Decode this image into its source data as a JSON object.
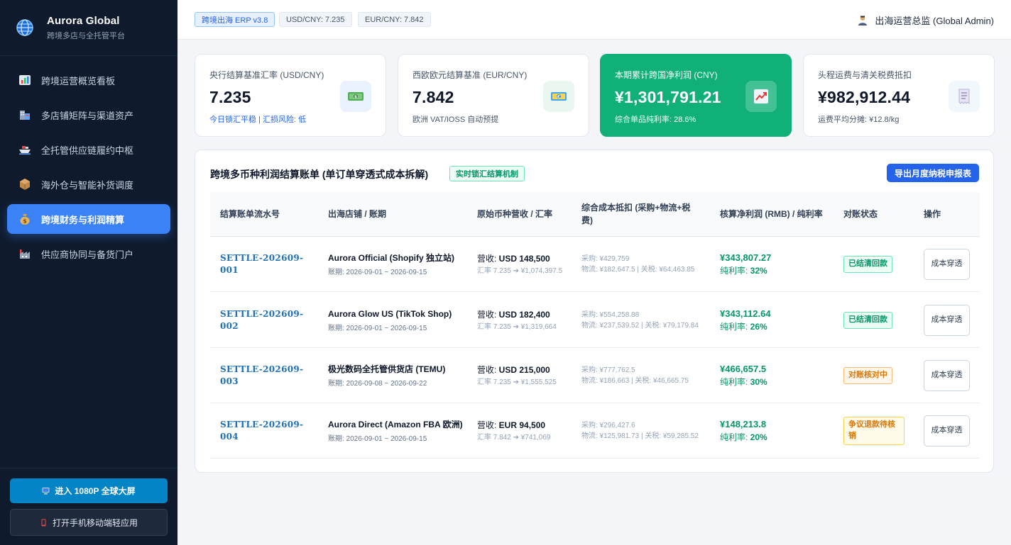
{
  "brand": {
    "title": "Aurora Global",
    "subtitle": "跨境多店与全托管平台"
  },
  "nav": [
    {
      "label": "跨境运营概览看板",
      "icon": "bar-chart-icon",
      "active": false
    },
    {
      "label": "多店铺矩阵与渠道资产",
      "icon": "store-icon",
      "active": false
    },
    {
      "label": "全托管供应链履约中枢",
      "icon": "ship-icon",
      "active": false
    },
    {
      "label": "海外仓与智能补货调度",
      "icon": "package-icon",
      "active": false
    },
    {
      "label": "跨境财务与利润精算",
      "icon": "money-bag-icon",
      "active": true
    },
    {
      "label": "供应商协同与备货门户",
      "icon": "factory-icon",
      "active": false
    }
  ],
  "sidebar_buttons": {
    "big_screen": "进入 1080P 全球大屏",
    "mobile": "打开手机移动端轻应用"
  },
  "topbar": {
    "erp_tag": "跨境出海 ERP v3.8",
    "rate_usd": "USD/CNY: 7.235",
    "rate_eur": "EUR/CNY: 7.842",
    "user": "出海运营总监 (Global Admin)"
  },
  "cards": [
    {
      "label": "央行结算基准汇率 (USD/CNY)",
      "value": "7.235",
      "note": "今日锁汇平稳 | 汇损风险: 低",
      "icon": "dollar-bill-icon"
    },
    {
      "label": "西欧欧元结算基准 (EUR/CNY)",
      "value": "7.842",
      "note": "欧洲 VAT/IOSS 自动预提",
      "icon": "euro-bill-icon"
    },
    {
      "label": "本期累计跨国净利润 (CNY)",
      "value": "¥1,301,791.21",
      "note": "综合单品纯利率: 28.6%",
      "icon": "trend-up-icon"
    },
    {
      "label": "头程运费与清关税费抵扣",
      "value": "¥982,912.44",
      "note": "运费平均分摊: ¥12.8/kg",
      "icon": "receipt-icon"
    }
  ],
  "ledger": {
    "title": "跨境多币种利润结算账单 (单订单穿透式成本拆解)",
    "tag": "实时锁汇结算机制",
    "export_label": "导出月度纳税申报表",
    "headers": [
      "结算账单流水号",
      "出海店铺 / 账期",
      "原始币种营收 / 汇率",
      "综合成本抵扣 (采购+物流+税费)",
      "核算净利润 (RMB) / 纯利率",
      "对账状态",
      "操作"
    ],
    "rows": [
      {
        "id": "SETTLE-202609-001",
        "store": "Aurora Official (Shopify 独立站)",
        "period": "账期: 2026-09-01 ~ 2026-09-15",
        "rev_prefix": "营收: ",
        "rev_amount": "USD 148,500",
        "rate_note": "汇率 7.235 ➔ ¥1,074,397.5",
        "cost_purchase": "采购: ¥429,759",
        "cost_logistics": "物流: ¥182,647.5 | 关税: ¥64,463.85",
        "profit": "¥343,807.27",
        "margin_prefix": "纯利率: ",
        "margin": "32%",
        "status": "已结清回款",
        "status_type": "ok",
        "action": "成本穿透"
      },
      {
        "id": "SETTLE-202609-002",
        "store": "Aurora Glow US (TikTok Shop)",
        "period": "账期: 2026-09-01 ~ 2026-09-15",
        "rev_prefix": "营收: ",
        "rev_amount": "USD 182,400",
        "rate_note": "汇率 7.235 ➔ ¥1,319,664",
        "cost_purchase": "采购: ¥554,258.88",
        "cost_logistics": "物流: ¥237,539.52 | 关税: ¥79,179.84",
        "profit": "¥343,112.64",
        "margin_prefix": "纯利率: ",
        "margin": "26%",
        "status": "已结清回款",
        "status_type": "ok",
        "action": "成本穿透"
      },
      {
        "id": "SETTLE-202609-003",
        "store": "极光数码全托管供货店 (TEMU)",
        "period": "账期: 2026-09-08 ~ 2026-09-22",
        "rev_prefix": "营收: ",
        "rev_amount": "USD 215,000",
        "rate_note": "汇率 7.235 ➔ ¥1,555,525",
        "cost_purchase": "采购: ¥777,762.5",
        "cost_logistics": "物流: ¥186,663 | 关税: ¥46,665.75",
        "profit": "¥466,657.5",
        "margin_prefix": "纯利率: ",
        "margin": "30%",
        "status": "对账核对中",
        "status_type": "pending",
        "action": "成本穿透"
      },
      {
        "id": "SETTLE-202609-004",
        "store": "Aurora Direct (Amazon FBA 欧洲)",
        "period": "账期: 2026-09-01 ~ 2026-09-15",
        "rev_prefix": "营收: ",
        "rev_amount": "EUR 94,500",
        "rate_note": "汇率 7.842 ➔ ¥741,069",
        "cost_purchase": "采购: ¥296,427.6",
        "cost_logistics": "物流: ¥125,981.73 | 关税: ¥59,285.52",
        "profit": "¥148,213.8",
        "margin_prefix": "纯利率: ",
        "margin": "20%",
        "status": "争议退款待核销",
        "status_type": "dispute",
        "action": "成本穿透"
      }
    ]
  }
}
